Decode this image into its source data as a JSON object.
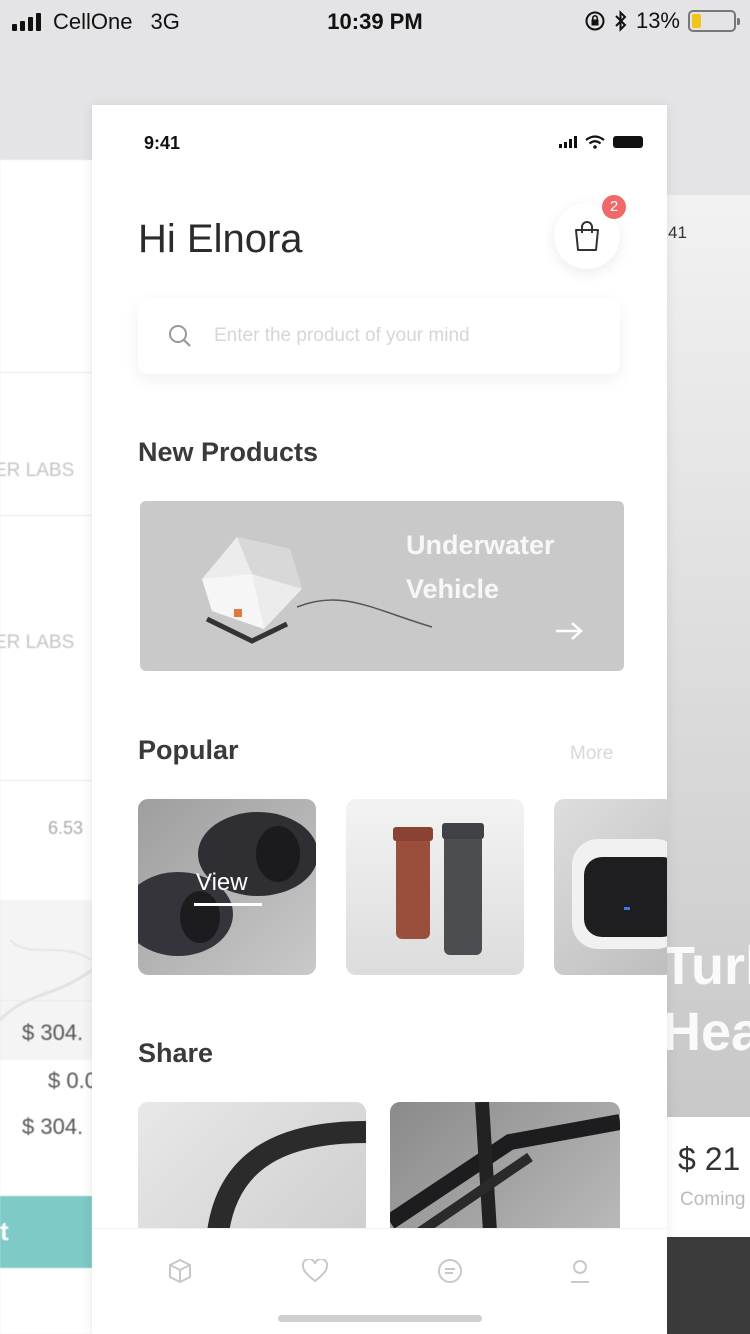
{
  "os_status": {
    "carrier": "CellOne",
    "network": "3G",
    "time": "10:39 PM",
    "battery": "13%",
    "battery_level": 0.13
  },
  "app_status": {
    "time": "9:41"
  },
  "header": {
    "greeting": "Hi Elnora",
    "cart_badge": "2"
  },
  "search": {
    "placeholder": "Enter the product of your mind"
  },
  "sections": {
    "new_products": "New Products",
    "popular": "Popular",
    "popular_more": "More",
    "share": "Share"
  },
  "banner": {
    "title": "Underwater Vehicle"
  },
  "popular_items": [
    {
      "overlay": "View"
    }
  ],
  "background_left": {
    "labels": [
      "ER LABS",
      "ER LABS"
    ],
    "value": "6.53",
    "amounts": [
      "$ 304.",
      "$ 0.0",
      "$ 304."
    ],
    "button": "t"
  },
  "background_right": {
    "time": "41",
    "big_text": [
      "Turb",
      "Head"
    ],
    "price": "$ 21",
    "coming": "Coming"
  },
  "tabs": [
    {
      "name": "tab-box",
      "icon": "box-icon"
    },
    {
      "name": "tab-favorites",
      "icon": "heart-icon"
    },
    {
      "name": "tab-messages",
      "icon": "chat-icon"
    },
    {
      "name": "tab-profile",
      "icon": "user-icon"
    }
  ],
  "colors": {
    "badge": "#f06868",
    "teal": "#7ecac6",
    "battery": "#f0c419"
  }
}
